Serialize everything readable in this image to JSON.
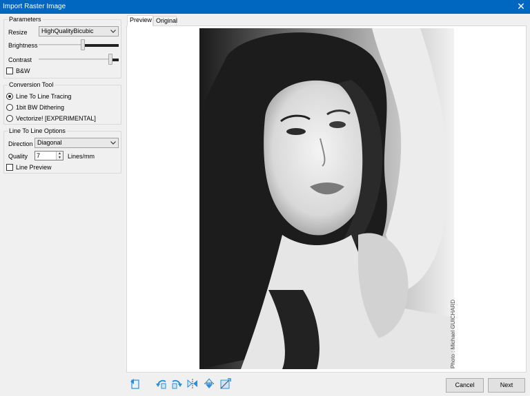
{
  "window": {
    "title": "Import Raster Image",
    "close_glyph": "✕"
  },
  "parameters": {
    "legend": "Parameters",
    "resize_label": "Resize",
    "resize_value": "HighQualityBicubic",
    "brightness_label": "Brightness",
    "brightness_level": 0.55,
    "contrast_label": "Contrast",
    "contrast_level": 0.92,
    "bw_label": "B&W",
    "bw_checked": false
  },
  "conversion": {
    "legend": "Conversion Tool",
    "options": [
      "Line To Line Tracing",
      "1bit BW Dithering",
      "Vectorize! [EXPERIMENTAL]"
    ],
    "selected": "Line To Line Tracing"
  },
  "line_options": {
    "legend": "Line To Line Options",
    "direction_label": "Direction",
    "direction_value": "Diagonal",
    "quality_label": "Quality",
    "quality_value": "7",
    "quality_unit": "Lines/mm",
    "line_preview_label": "Line Preview",
    "line_preview_checked": false
  },
  "tabs": [
    "Preview",
    "Original"
  ],
  "active_tab": "Preview",
  "preview": {
    "credit": "Photo : Michael GUICHARD"
  },
  "toolbar_icons": [
    "reset-icon",
    "rotate-left-icon",
    "rotate-right-icon",
    "flip-horizontal-icon",
    "flip-vertical-icon",
    "invert-icon"
  ],
  "buttons": {
    "cancel": "Cancel",
    "next": "Next"
  },
  "colors": {
    "titlebar": "#0067c0",
    "window_bg": "#f0f0f0",
    "icon_blue": "#2a8fd8"
  }
}
